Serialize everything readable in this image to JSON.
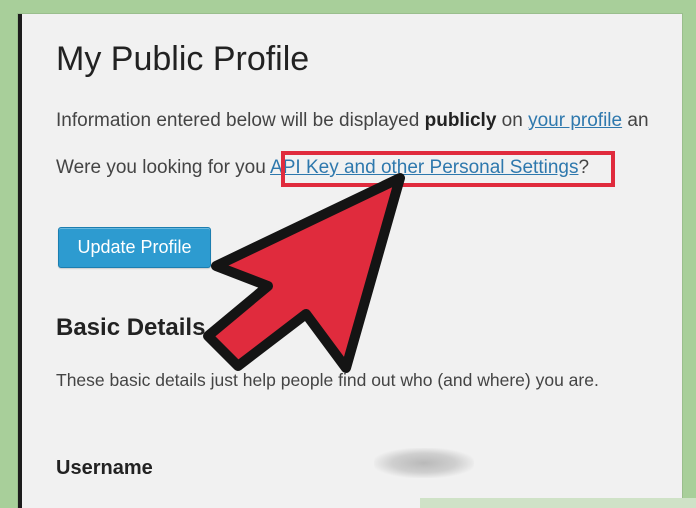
{
  "page": {
    "title": "My Public Profile",
    "info_prefix": "Information entered below will be displayed ",
    "info_bold": "publicly",
    "info_mid": " on ",
    "info_link": "your profile",
    "info_suffix": " an",
    "looking_prefix": "Were you looking for you ",
    "looking_link": "API Key and other Personal Settings",
    "looking_suffix": "?",
    "update_button": "Update Profile",
    "section_title": "Basic Details",
    "section_desc": "These basic details just help people find out who (and where) you are.",
    "username_label": "Username",
    "username_value": ""
  },
  "colors": {
    "background": "#a8cf9a",
    "page": "#f1f1f1",
    "link": "#2e78ad",
    "button": "#2d9bd0",
    "highlight": "#e02b3d",
    "arrow": "#e02b3d"
  },
  "icons": {
    "pointer_arrow": "big-red-arrow-icon"
  }
}
